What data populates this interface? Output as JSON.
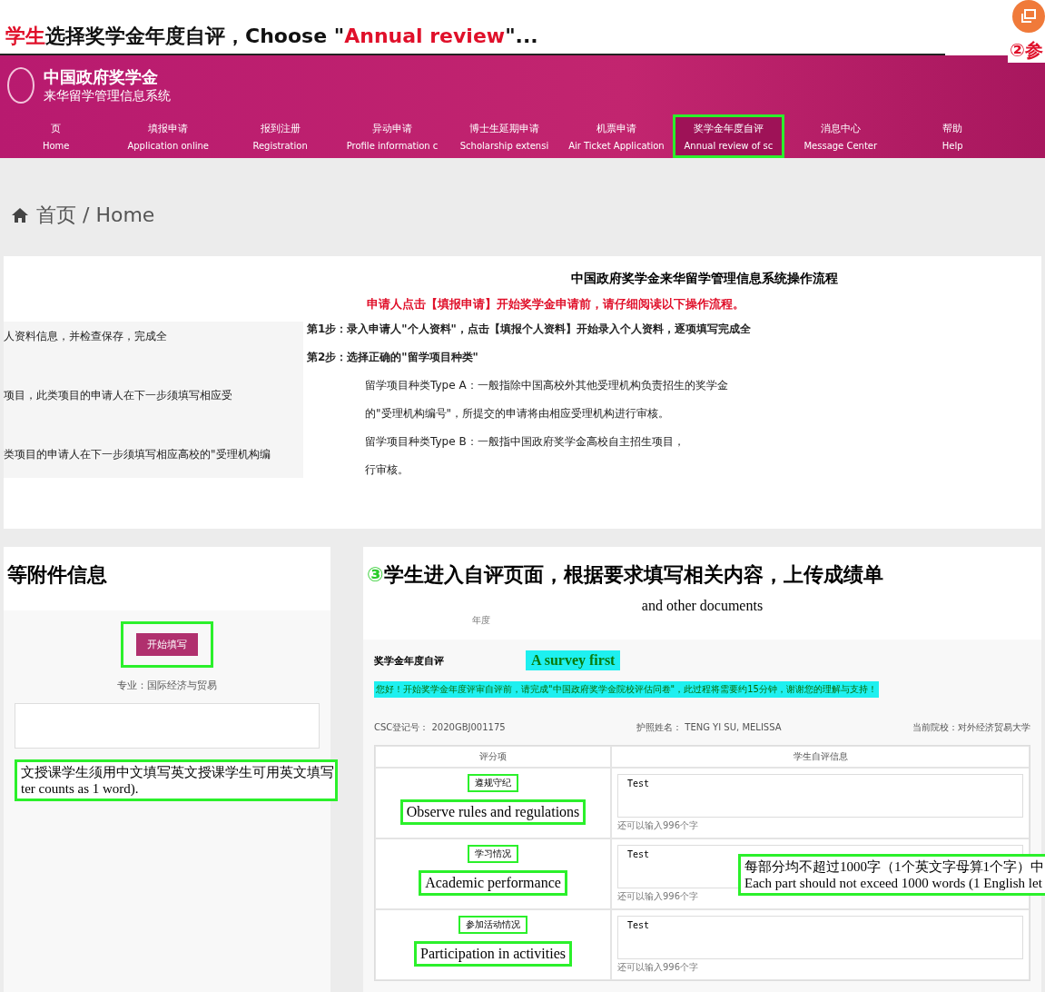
{
  "step_title": {
    "parts": [
      {
        "text": "学生",
        "kind": "accent"
      },
      {
        "text": "选择奖学金年度自评，Choose \"",
        "kind": "plain"
      },
      {
        "text": "Annual review",
        "kind": "accent"
      },
      {
        "text": "\"...",
        "kind": "plain"
      }
    ],
    "corner_text": "②参"
  },
  "header": {
    "title": "中国政府奖学金",
    "subtitle": "来华留学管理信息系统"
  },
  "nav": [
    {
      "label": "页",
      "english": "Home",
      "selected": false
    },
    {
      "label": "填报申请",
      "english": "Application online",
      "selected": false
    },
    {
      "label": "报到注册",
      "english": "Registration",
      "selected": false
    },
    {
      "label": "异动申请",
      "english": "Profile information c",
      "selected": false
    },
    {
      "label": "博士生延期申请",
      "english": "Scholarship extensi",
      "selected": false
    },
    {
      "label": "机票申请",
      "english": "Air Ticket Application",
      "selected": false
    },
    {
      "label": "奖学金年度自评",
      "english": "Annual review of sc",
      "selected": true
    },
    {
      "label": "消息中心",
      "english": "Message Center",
      "selected": false
    },
    {
      "label": "帮助",
      "english": "Help",
      "selected": false
    }
  ],
  "breadcrumb": "首页 / Home",
  "guide": {
    "title": "中国政府奖学金来华留学管理信息系统操作流程",
    "notice": "申请人点击【填报申请】开始奖学金申请前，请仔细阅读以下操作流程。",
    "left_lines": [
      "人资料信息，并检查保存，完成全",
      "项目，此类项目的申请人在下一步须填写相应受",
      "类项目的申请人在下一步须填写相应高校的\"受理机构编"
    ],
    "right_lines": [
      {
        "text": "第1步：录入申请人\"个人资料\"，点击【填报个人资料】开始录入个人资料，逐项填写完成全",
        "kind": "step"
      },
      {
        "text": "第2步：选择正确的\"留学项目种类\"",
        "kind": "step"
      },
      {
        "text": "留学项目种类Type A：一般指除中国高校外其他受理机构负责招生的奖学金",
        "kind": "bullet"
      },
      {
        "text": "的\"受理机构编号\"，所提交的申请将由相应受理机构进行审核。",
        "kind": "indent"
      },
      {
        "text": "留学项目种类Type B：一般指中国政府奖学金高校自主招生项目，",
        "kind": "bullet"
      },
      {
        "text": "行审核。",
        "kind": "indent"
      }
    ]
  },
  "left_panel": {
    "heading": "等附件信息",
    "start_button": "开始填写",
    "major": "专业：国际经济与贸易",
    "note_lines": [
      "文授课学生须用中文填写英文授课学生可用英文填写",
      "ter counts as 1 word)."
    ]
  },
  "right_panel": {
    "heading_mark": "③",
    "heading": "学生进入自评页面，根据要求填写相关内容，上传成绩单",
    "subheading": "and other documents",
    "year_label": "年度",
    "form_title": "奖学金年度自评",
    "callout": "A survey first",
    "survey_notice": "您好！开始奖学金年度评审自评前，请完成\"中国政府奖学金院校评估问卷\"，此过程将需要约15分钟，谢谢您的理解与支持！",
    "csc_no": "CSC登记号： 2020GBJ001175",
    "passport_name": "护照姓名： TENG YI SU, MELISSA",
    "school": "当前院校：对外经济贸易大学",
    "columns": [
      "评分项",
      "学生自评信息"
    ],
    "rows": [
      {
        "item": "遵规守纪",
        "english": "Observe rules and regulations",
        "value": "Test",
        "remaining": "还可以输入996个字"
      },
      {
        "item": "学习情况",
        "english": "Academic performance",
        "value": "Test",
        "remaining": "还可以输入996个字"
      },
      {
        "item": "参加活动情况",
        "english": "Participation in activities",
        "value": "Test",
        "remaining": "还可以输入996个字"
      }
    ],
    "limit_note": [
      "每部分均不超过1000字（1个英文字母算1个字）中",
      "Each part should not exceed 1000 words (1 English let"
    ]
  }
}
